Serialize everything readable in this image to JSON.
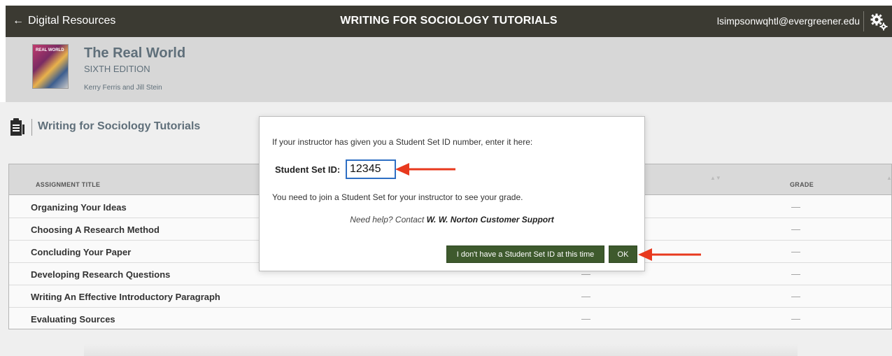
{
  "header": {
    "back_label": "Digital Resources",
    "title": "WRITING FOR SOCIOLOGY TUTORIALS",
    "user_email": "lsimpsonwqhtl@evergreener.edu"
  },
  "book": {
    "cover_text": "REAL WORLD",
    "title": "The Real World",
    "edition": "SIXTH EDITION",
    "authors": "Kerry Ferris and Jill Stein"
  },
  "section": {
    "title": "Writing for Sociology Tutorials"
  },
  "table": {
    "col_title": "ASSIGNMENT TITLE",
    "col_grade": "GRADE",
    "rows": [
      {
        "name": "Organizing Your Ideas",
        "d1": "",
        "d2": "—"
      },
      {
        "name": "Choosing A Research Method",
        "d1": "",
        "d2": "—"
      },
      {
        "name": "Concluding Your Paper",
        "d1": "",
        "d2": "—"
      },
      {
        "name": "Developing Research Questions",
        "d1": "—",
        "d2": "—"
      },
      {
        "name": "Writing An Effective Introductory Paragraph",
        "d1": "—",
        "d2": "—"
      },
      {
        "name": "Evaluating Sources",
        "d1": "—",
        "d2": "—"
      }
    ]
  },
  "modal": {
    "instruction": "If your instructor has given you a Student Set ID number, enter it here:",
    "label": "Student Set ID:",
    "input_value": "12345",
    "join_text": "You need to join a Student Set for your instructor to see your grade.",
    "help_prefix": "Need help? Contact ",
    "help_link": "W. W. Norton Customer Support",
    "btn_no_id": "I don't have a Student Set ID at this time",
    "btn_ok": "OK"
  },
  "colors": {
    "topbar": "#3b3a32",
    "button_green": "#3e5a2d",
    "annotation_red": "#e8391e",
    "accent_text": "#5f6f7a"
  }
}
